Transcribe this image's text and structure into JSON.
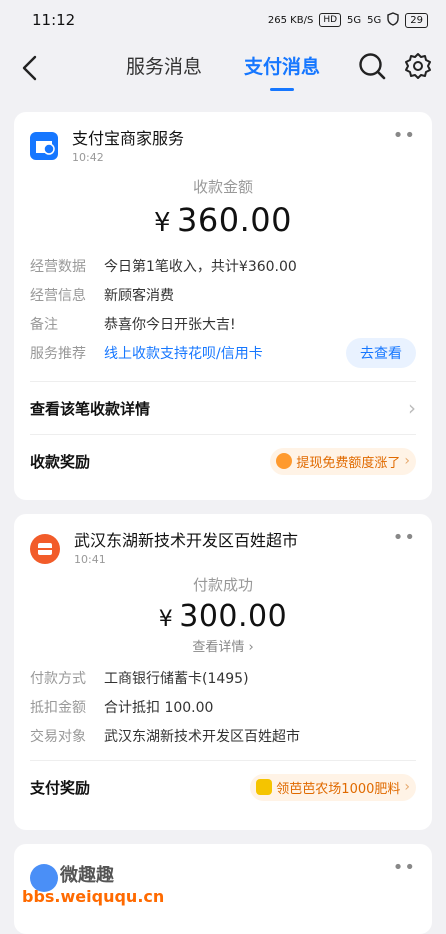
{
  "status": {
    "time": "11:12",
    "speed": "265 KB/S",
    "hd": "HD",
    "net1": "5G",
    "net2": "5G",
    "battery": "29"
  },
  "nav": {
    "tabs": [
      {
        "label": "服务消息",
        "active": false
      },
      {
        "label": "支付消息",
        "active": true
      }
    ]
  },
  "card1": {
    "merchant": "支付宝商家服务",
    "time": "10:42",
    "amount_label": "收款金额",
    "currency": "¥",
    "amount": "360.00",
    "rows": [
      {
        "k": "经营数据",
        "v": "今日第1笔收入，共计¥360.00"
      },
      {
        "k": "经营信息",
        "v": "新顾客消费"
      },
      {
        "k": "备注",
        "v": "恭喜你今日开张大吉!"
      },
      {
        "k": "服务推荐",
        "v": "线上收款支持花呗/信用卡"
      }
    ],
    "go_button": "去查看",
    "detail_line": "查看该笔收款详情",
    "reward_title": "收款奖励",
    "reward_pill": "提现免费额度涨了"
  },
  "card2": {
    "merchant": "武汉东湖新技术开发区百姓超市",
    "time": "10:41",
    "amount_label": "付款成功",
    "currency": "¥",
    "amount": "300.00",
    "detail_link": "查看详情",
    "rows": [
      {
        "k": "付款方式",
        "v": "工商银行储蓄卡(1495)"
      },
      {
        "k": "抵扣金额",
        "v": "合计抵扣 100.00"
      },
      {
        "k": "交易对象",
        "v": "武汉东湖新技术开发区百姓超市"
      }
    ],
    "reward_title": "支付奖励",
    "reward_pill": "领芭芭农场1000肥料"
  },
  "watermark": {
    "title": "微趣趣",
    "url": "bbs.weiququ.cn"
  }
}
